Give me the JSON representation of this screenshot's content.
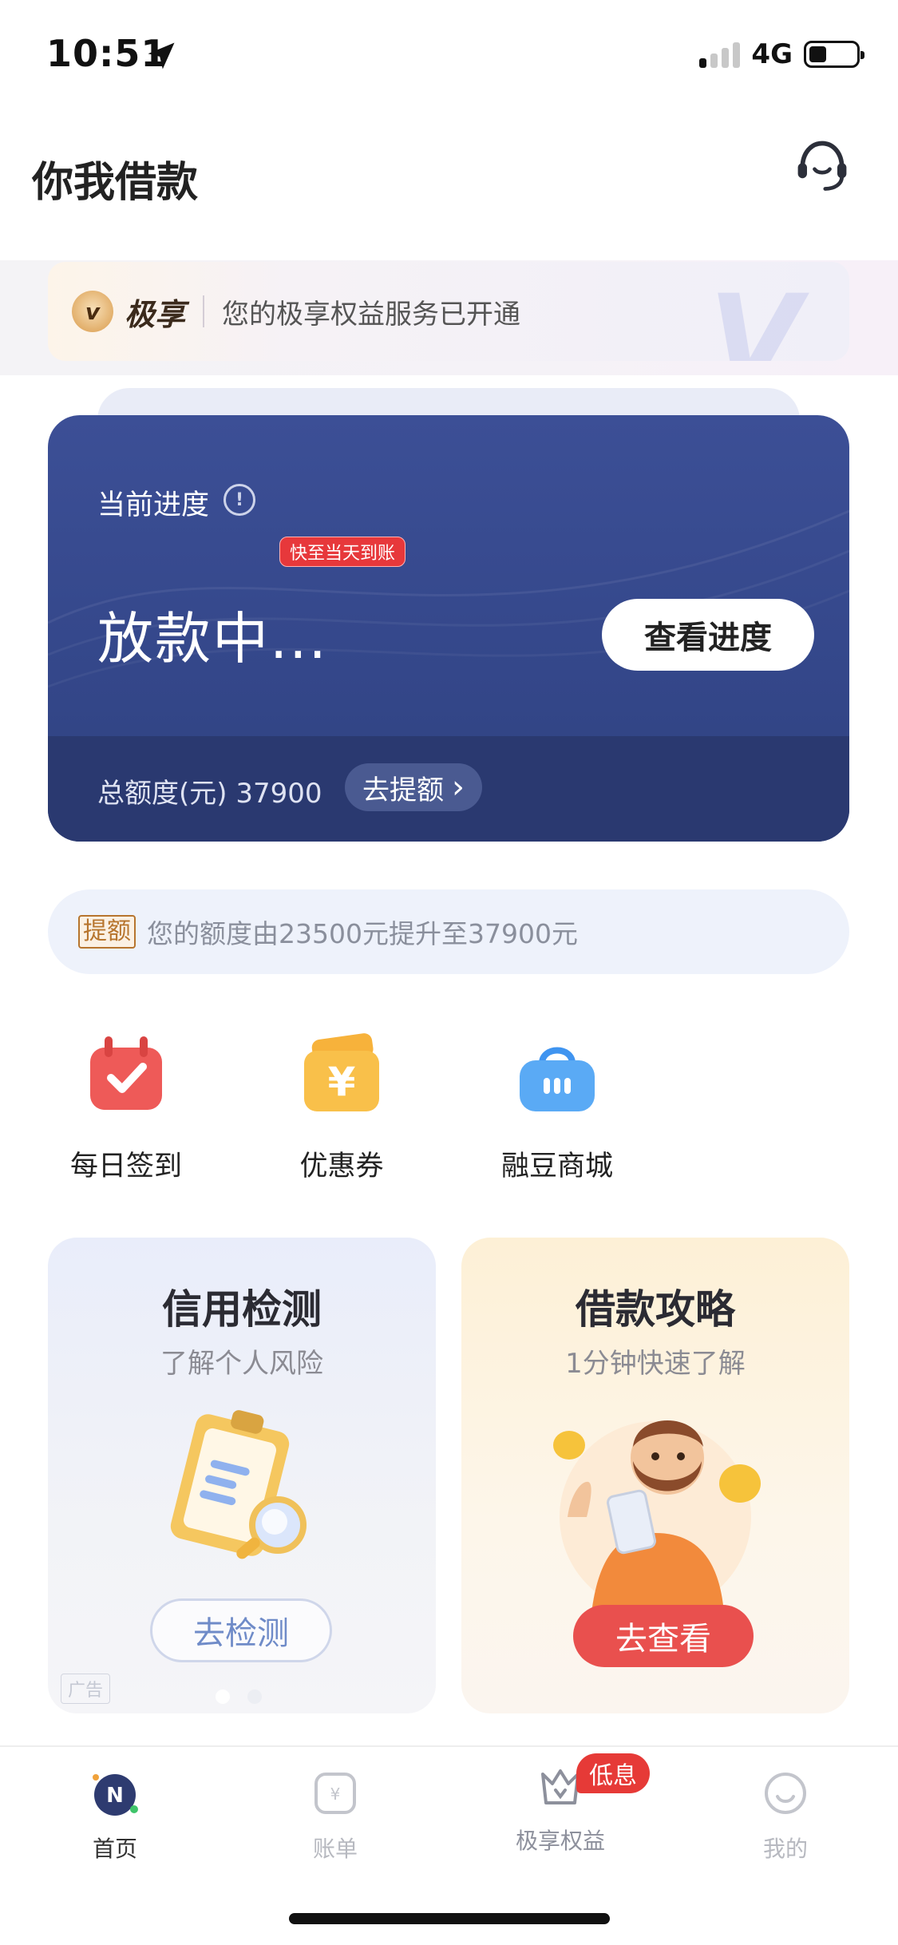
{
  "status_bar": {
    "time": "10:51",
    "network": "4G",
    "icons": [
      "location-arrow-icon",
      "signal-icon",
      "battery-icon"
    ]
  },
  "header": {
    "title": "你我借款",
    "support_icon": "headset-icon"
  },
  "jixiang_banner": {
    "logo_letter": "v",
    "brand": "极享",
    "message": "您的极享权益服务已开通",
    "watermark": "V"
  },
  "loan_card": {
    "progress_label": "当前进度",
    "info_icon": "!",
    "badge": "快至当天到账",
    "status": "放款中...",
    "view_progress_button": "查看进度",
    "quota_text": "总额度(元) 37900",
    "raise_button": "去提额",
    "raise_arrow": "›"
  },
  "raise_notice": {
    "tag": "提额",
    "message": "您的额度由23500元提升至37900元"
  },
  "quick_entries": [
    {
      "label": "每日签到",
      "icon": "calendar-check-icon"
    },
    {
      "label": "优惠券",
      "icon": "coupon-yen-icon"
    },
    {
      "label": "融豆商城",
      "icon": "shopping-bag-icon"
    }
  ],
  "promo_cards": {
    "credit": {
      "title": "信用检测",
      "subtitle": "了解个人风险",
      "button": "去检测",
      "ad_tag": "广告"
    },
    "guide": {
      "title": "借款攻略",
      "subtitle": "1分钟快速了解",
      "button": "去查看"
    }
  },
  "tabbar": {
    "tabs": [
      {
        "label": "首页",
        "icon": "home-n-icon",
        "active": true
      },
      {
        "label": "账单",
        "icon": "bill-icon",
        "active": false
      },
      {
        "label": "极享权益",
        "icon": "crown-icon",
        "active": false
      },
      {
        "label": "我的",
        "icon": "profile-icon",
        "active": false
      }
    ],
    "badge": "低息"
  },
  "colors": {
    "card_blue": "#3c4f96",
    "card_lower": "#2a3970",
    "accent_red": "#e63a37",
    "raise_tag": "#b7752e"
  }
}
